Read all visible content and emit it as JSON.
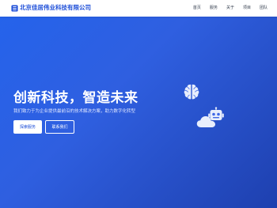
{
  "header": {
    "brand": "北京佳居伟业科技有限公司",
    "nav": [
      "首页",
      "服务",
      "关于",
      "项目",
      "团队"
    ]
  },
  "hero": {
    "title": "创新科技，智造未来",
    "subtitle": "我们致力于为企业提供最前沿的技术解决方案，助力数字化转型",
    "primary_button": "探索服务",
    "secondary_button": "联系我们"
  },
  "icons": [
    "building-icon",
    "brain-icon",
    "robot-icon",
    "cloud-icon"
  ],
  "colors": {
    "brand": "#1d4ed8",
    "hero_start": "#2563eb",
    "hero_end": "#1e40af"
  }
}
